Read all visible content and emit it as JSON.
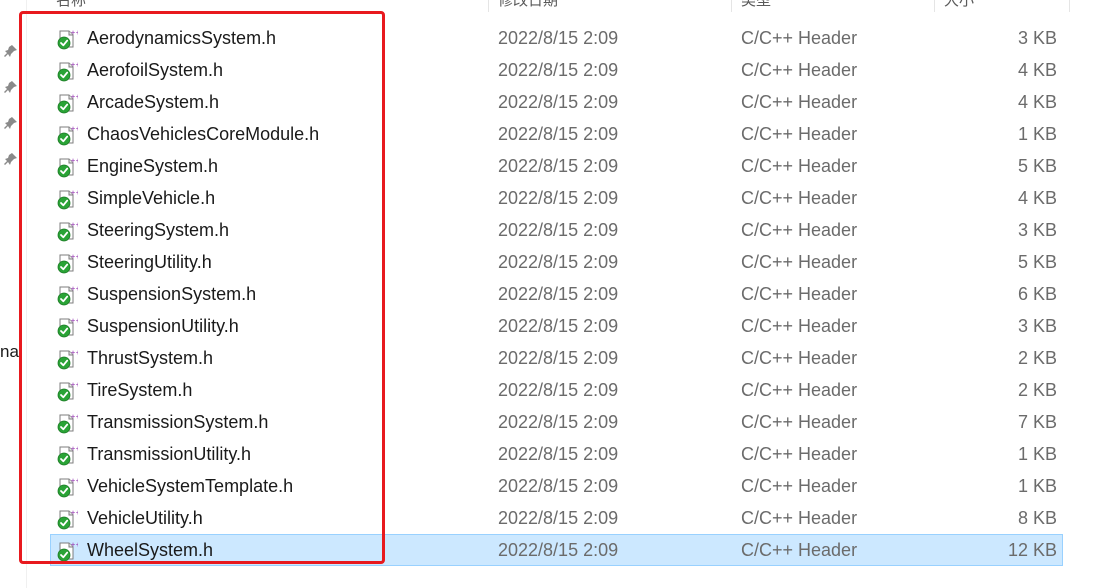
{
  "header": {
    "columns": [
      {
        "key": "name",
        "label": "名称"
      },
      {
        "key": "date",
        "label": "修改日期"
      },
      {
        "key": "type",
        "label": "类型"
      },
      {
        "key": "size",
        "label": "大小"
      }
    ]
  },
  "nav_fragment": "na",
  "colors": {
    "selected_row": "#cce8ff",
    "annotation_box": "#e8191e",
    "icon_badge": "#2aa336"
  },
  "files": [
    {
      "name": "AerodynamicsSystem.h",
      "date": "2022/8/15 2:09",
      "type": "C/C++ Header",
      "size": "3 KB",
      "icon": "cpp-header-icon"
    },
    {
      "name": "AerofoilSystem.h",
      "date": "2022/8/15 2:09",
      "type": "C/C++ Header",
      "size": "4 KB",
      "icon": "cpp-header-icon"
    },
    {
      "name": "ArcadeSystem.h",
      "date": "2022/8/15 2:09",
      "type": "C/C++ Header",
      "size": "4 KB",
      "icon": "cpp-header-icon"
    },
    {
      "name": "ChaosVehiclesCoreModule.h",
      "date": "2022/8/15 2:09",
      "type": "C/C++ Header",
      "size": "1 KB",
      "icon": "cpp-header-icon"
    },
    {
      "name": "EngineSystem.h",
      "date": "2022/8/15 2:09",
      "type": "C/C++ Header",
      "size": "5 KB",
      "icon": "cpp-header-icon"
    },
    {
      "name": "SimpleVehicle.h",
      "date": "2022/8/15 2:09",
      "type": "C/C++ Header",
      "size": "4 KB",
      "icon": "cpp-header-icon"
    },
    {
      "name": "SteeringSystem.h",
      "date": "2022/8/15 2:09",
      "type": "C/C++ Header",
      "size": "3 KB",
      "icon": "cpp-header-icon"
    },
    {
      "name": "SteeringUtility.h",
      "date": "2022/8/15 2:09",
      "type": "C/C++ Header",
      "size": "5 KB",
      "icon": "cpp-header-icon"
    },
    {
      "name": "SuspensionSystem.h",
      "date": "2022/8/15 2:09",
      "type": "C/C++ Header",
      "size": "6 KB",
      "icon": "cpp-header-icon"
    },
    {
      "name": "SuspensionUtility.h",
      "date": "2022/8/15 2:09",
      "type": "C/C++ Header",
      "size": "3 KB",
      "icon": "cpp-header-icon"
    },
    {
      "name": "ThrustSystem.h",
      "date": "2022/8/15 2:09",
      "type": "C/C++ Header",
      "size": "2 KB",
      "icon": "cpp-header-icon"
    },
    {
      "name": "TireSystem.h",
      "date": "2022/8/15 2:09",
      "type": "C/C++ Header",
      "size": "2 KB",
      "icon": "cpp-header-icon"
    },
    {
      "name": "TransmissionSystem.h",
      "date": "2022/8/15 2:09",
      "type": "C/C++ Header",
      "size": "7 KB",
      "icon": "cpp-header-icon"
    },
    {
      "name": "TransmissionUtility.h",
      "date": "2022/8/15 2:09",
      "type": "C/C++ Header",
      "size": "1 KB",
      "icon": "cpp-header-icon"
    },
    {
      "name": "VehicleSystemTemplate.h",
      "date": "2022/8/15 2:09",
      "type": "C/C++ Header",
      "size": "1 KB",
      "icon": "cpp-header-icon"
    },
    {
      "name": "VehicleUtility.h",
      "date": "2022/8/15 2:09",
      "type": "C/C++ Header",
      "size": "8 KB",
      "icon": "cpp-header-icon"
    },
    {
      "name": "WheelSystem.h",
      "date": "2022/8/15 2:09",
      "type": "C/C++ Header",
      "size": "12 KB",
      "icon": "cpp-header-icon",
      "selected": true
    }
  ]
}
